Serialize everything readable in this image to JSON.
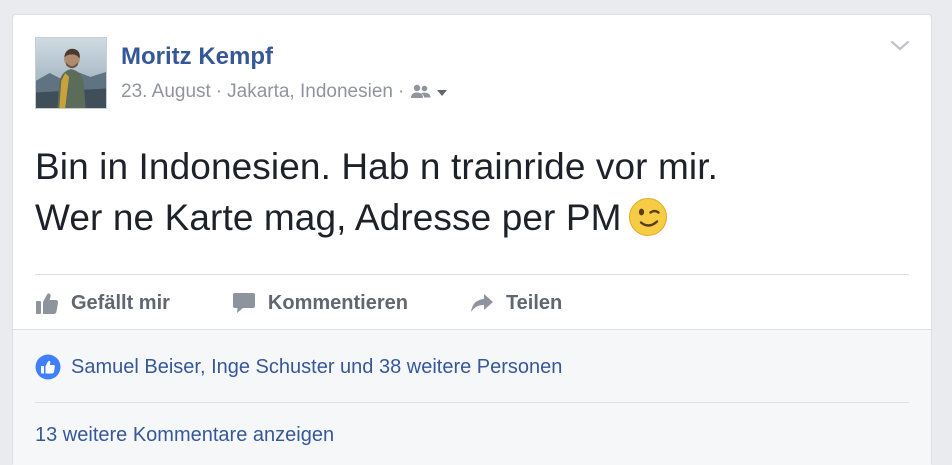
{
  "post": {
    "author": "Moritz Kempf",
    "date": "23. August",
    "location": "Jakarta, Indonesien",
    "separator": "·",
    "audience_icon": "friends-icon",
    "text_line1": "Bin in Indonesien. Hab n trainride vor mir.",
    "text_line2": "Wer ne Karte mag, Adresse per PM",
    "emoji": "winking-face-emoji"
  },
  "actions": {
    "like_label": "Gefällt mir",
    "comment_label": "Kommentieren",
    "share_label": "Teilen"
  },
  "social": {
    "likes_text": "Samuel Beiser, Inge Schuster und 38 weitere Personen",
    "more_comments": "13 weitere Kommentare anzeigen"
  },
  "colors": {
    "link": "#365899",
    "meta": "#90949c",
    "action": "#606770",
    "like_badge": "#4080ff"
  }
}
